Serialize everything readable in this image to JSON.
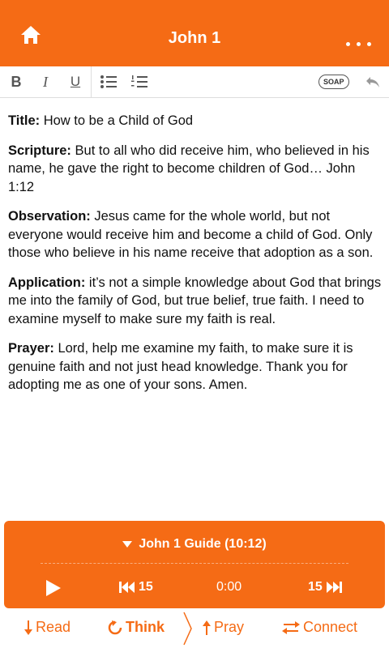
{
  "header": {
    "title": "John 1"
  },
  "toolbar": {
    "soap_label": "SOAP"
  },
  "content": {
    "title_label": "Title:",
    "title_text": " How to be a Child of God",
    "scripture_label": "Scripture:",
    "scripture_text": " But to all who did receive him, who believed in his name, he gave the right to become children of God… John 1:12",
    "observation_label": "Observation:",
    "observation_text": " Jesus came for the whole world, but not everyone would receive him and become a child of God. Only those who believe in his name receive that adoption as a son.",
    "application_label": "Application:",
    "application_text": " it’s not a simple knowledge about God that brings me into the family of God, but true belief, true faith. I need to examine myself to make sure my faith is real.",
    "prayer_label": "Prayer:",
    "prayer_text": " Lord, help me examine my faith, to make sure it is genuine faith and not just head knowledge. Thank you for adopting me as one of your sons. Amen."
  },
  "player": {
    "guide_title": "John 1 Guide (10:12)",
    "skip_back": "15",
    "time": "0:00",
    "skip_forward": "15"
  },
  "nav": {
    "read": "Read",
    "think": "Think",
    "pray": "Pray",
    "connect": "Connect"
  },
  "colors": {
    "accent": "#f56b15"
  }
}
